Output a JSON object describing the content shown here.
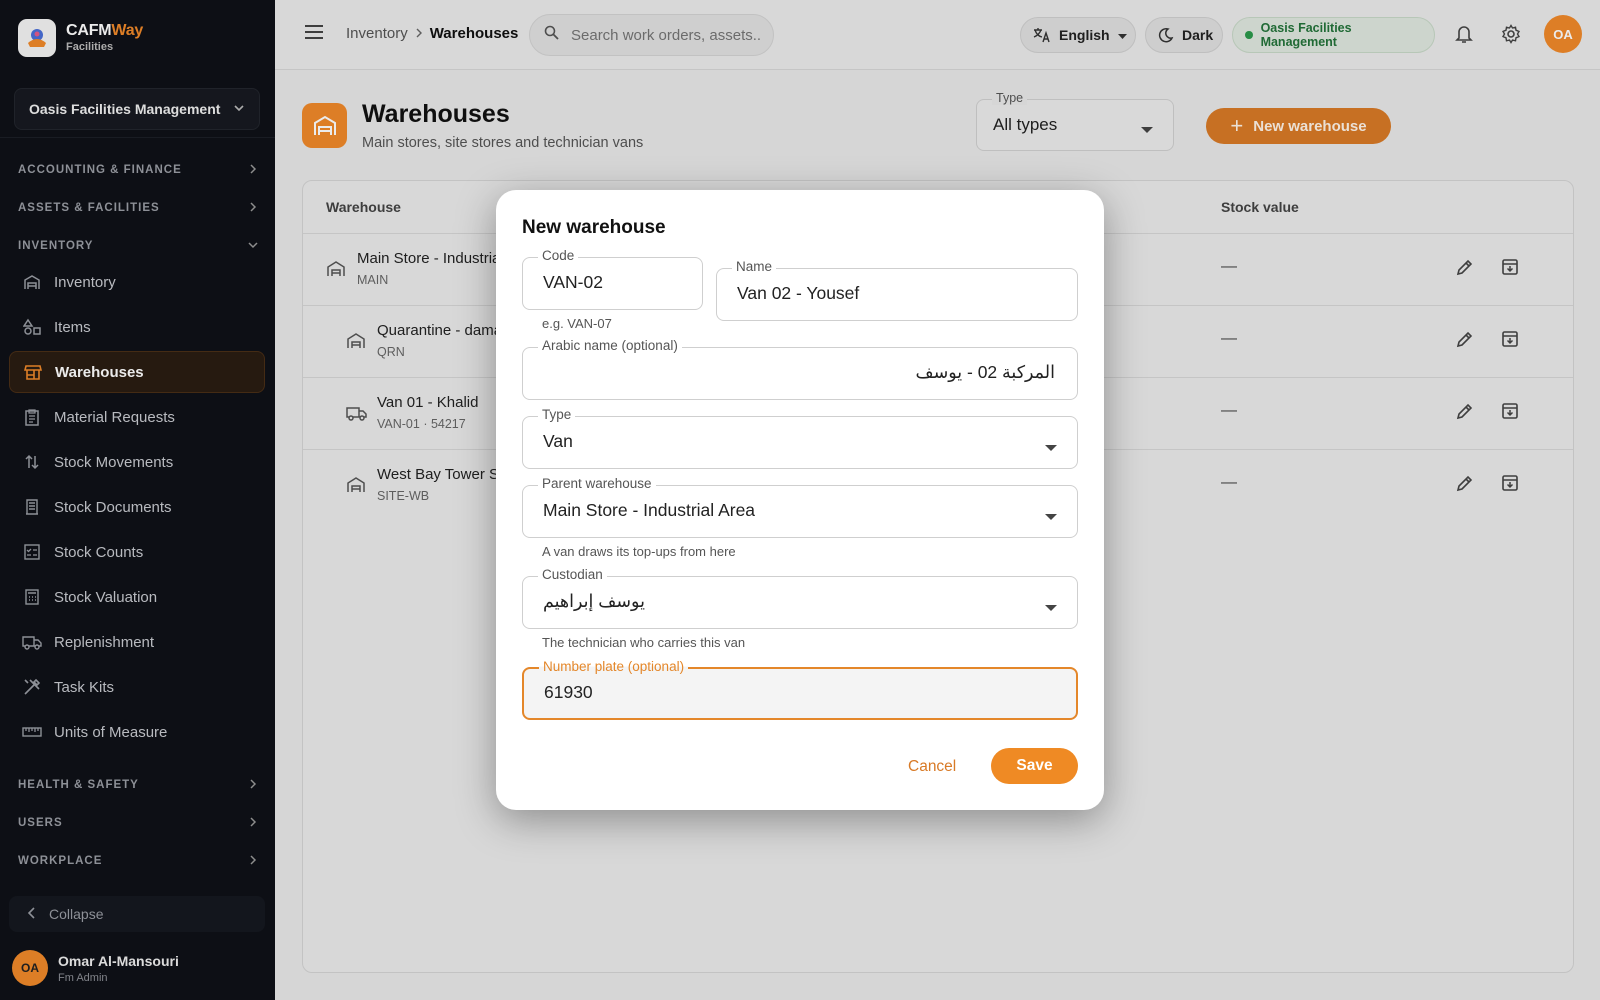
{
  "app": {
    "brand_name_a": "CAFM",
    "brand_name_b": "Way",
    "brand_sub": "Facilities",
    "accent_color": "#f0892a"
  },
  "sidebar": {
    "org": "Oasis Facilities Management",
    "sections": [
      {
        "label": "ACCOUNTING & FINANCE",
        "expanded": false
      },
      {
        "label": "ASSETS & FACILITIES",
        "expanded": false
      },
      {
        "label": "INVENTORY",
        "expanded": true
      },
      {
        "label": "HEALTH & SAFETY",
        "expanded": false
      },
      {
        "label": "USERS",
        "expanded": false
      },
      {
        "label": "WORKPLACE",
        "expanded": false
      }
    ],
    "items": [
      {
        "label": "Inventory",
        "icon": "warehouse-icon"
      },
      {
        "label": "Items",
        "icon": "shapes-icon"
      },
      {
        "label": "Warehouses",
        "icon": "store-icon",
        "active": true
      },
      {
        "label": "Material Requests",
        "icon": "clipboard-icon"
      },
      {
        "label": "Stock Movements",
        "icon": "swap-vertical-icon"
      },
      {
        "label": "Stock Documents",
        "icon": "receipt-icon"
      },
      {
        "label": "Stock Counts",
        "icon": "checklist-icon"
      },
      {
        "label": "Stock Valuation",
        "icon": "calculator-icon"
      },
      {
        "label": "Replenishment",
        "icon": "truck-icon"
      },
      {
        "label": "Task Kits",
        "icon": "tools-icon"
      },
      {
        "label": "Units of Measure",
        "icon": "ruler-icon"
      }
    ],
    "collapse_label": "Collapse",
    "user": {
      "initials": "OA",
      "name": "Omar Al-Mansouri",
      "role": "Fm Admin"
    }
  },
  "topbar": {
    "breadcrumb": [
      "Inventory",
      "Warehouses"
    ],
    "search_placeholder": "Search work orders, assets...",
    "language": "English",
    "theme": "Dark",
    "org_badge": "Oasis Facilities Management",
    "avatar_initials": "OA"
  },
  "page": {
    "title": "Warehouses",
    "subtitle": "Main stores, site stores and technician vans",
    "type_filter_label": "Type",
    "type_filter_value": "All types",
    "new_button": "New warehouse"
  },
  "table": {
    "columns": [
      "Warehouse",
      "Stock value"
    ],
    "rows": [
      {
        "name": "Main Store - Industrial Area",
        "code": "MAIN",
        "icon": "warehouse-icon",
        "value": "—",
        "indent": false
      },
      {
        "name": "Quarantine - damaged",
        "code": "QRN",
        "icon": "warehouse-icon",
        "value": "—",
        "indent": true
      },
      {
        "name": "Van 01 - Khalid",
        "code": "VAN-01 · 54217",
        "icon": "truck-icon",
        "value": "—",
        "indent": true
      },
      {
        "name": "West Bay Tower Site",
        "code": "SITE-WB",
        "icon": "warehouse-icon",
        "value": "—",
        "indent": true
      }
    ]
  },
  "dialog": {
    "title": "New warehouse",
    "code_label": "Code",
    "code_value": "VAN-02",
    "code_helper": "e.g. VAN-07",
    "name_label": "Name",
    "name_value": "Van 02 - Yousef",
    "arabic_label": "Arabic name (optional)",
    "arabic_value": "المركبة 02 - يوسف",
    "type_label": "Type",
    "type_value": "Van",
    "parent_label": "Parent warehouse",
    "parent_value": "Main Store - Industrial Area",
    "parent_helper": "A van draws its top-ups from here",
    "custodian_label": "Custodian",
    "custodian_value": "يوسف إبراهيم",
    "custodian_helper": "The technician who carries this van",
    "plate_label": "Number plate (optional)",
    "plate_value": "61930",
    "cancel_label": "Cancel",
    "save_label": "Save"
  }
}
